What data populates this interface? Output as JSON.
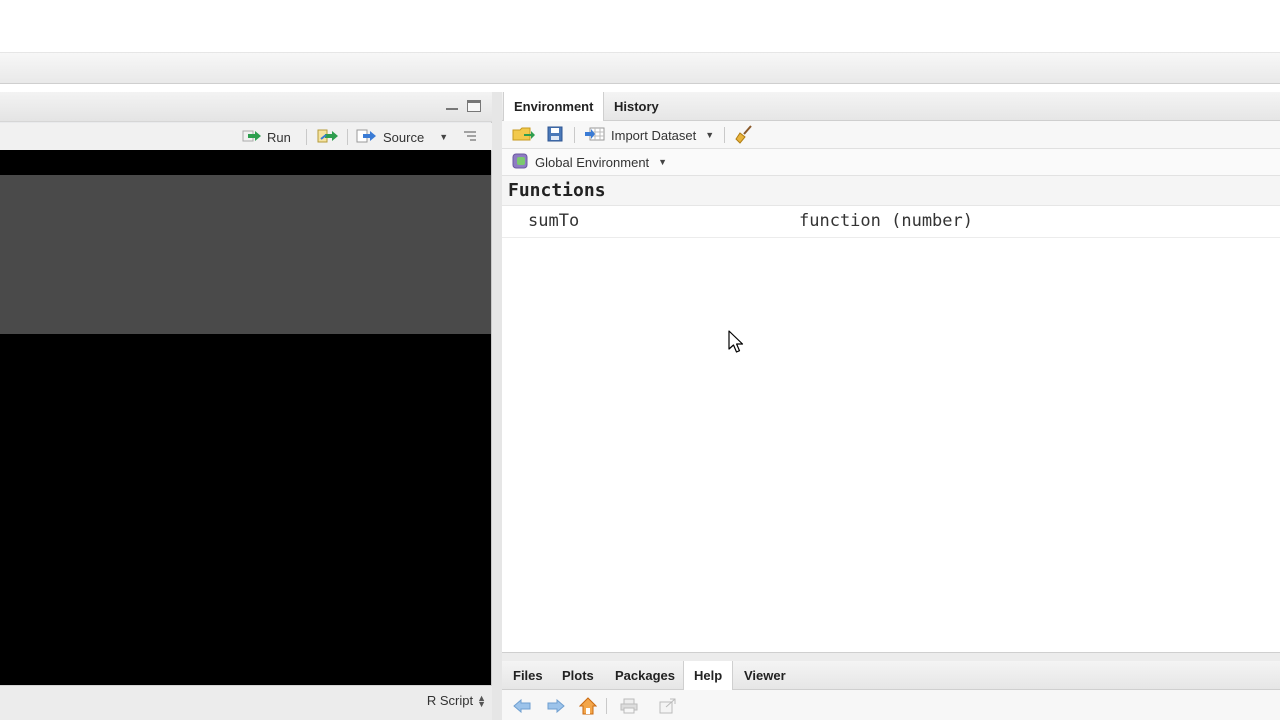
{
  "source_pane": {
    "toolbar": {
      "run_label": "Run",
      "source_label": "Source"
    },
    "status": {
      "file_type": "R Script"
    }
  },
  "environment_pane": {
    "tabs": [
      {
        "label": "Environment",
        "active": true
      },
      {
        "label": "History",
        "active": false
      }
    ],
    "toolbar": {
      "import_label": "Import Dataset"
    },
    "scope": {
      "label": "Global Environment"
    },
    "sections": [
      {
        "title": "Functions",
        "rows": [
          {
            "name": "sumTo",
            "value": "function (number)"
          }
        ]
      }
    ]
  },
  "files_pane": {
    "tabs": [
      {
        "label": "Files",
        "active": false
      },
      {
        "label": "Plots",
        "active": false
      },
      {
        "label": "Packages",
        "active": false
      },
      {
        "label": "Help",
        "active": true
      },
      {
        "label": "Viewer",
        "active": false
      }
    ]
  },
  "colors": {
    "editor_background": "#000000",
    "editor_selection": "#4a4a4a",
    "run_arrow": "#2e9e4f",
    "source_arrow": "#3a7bd5"
  }
}
